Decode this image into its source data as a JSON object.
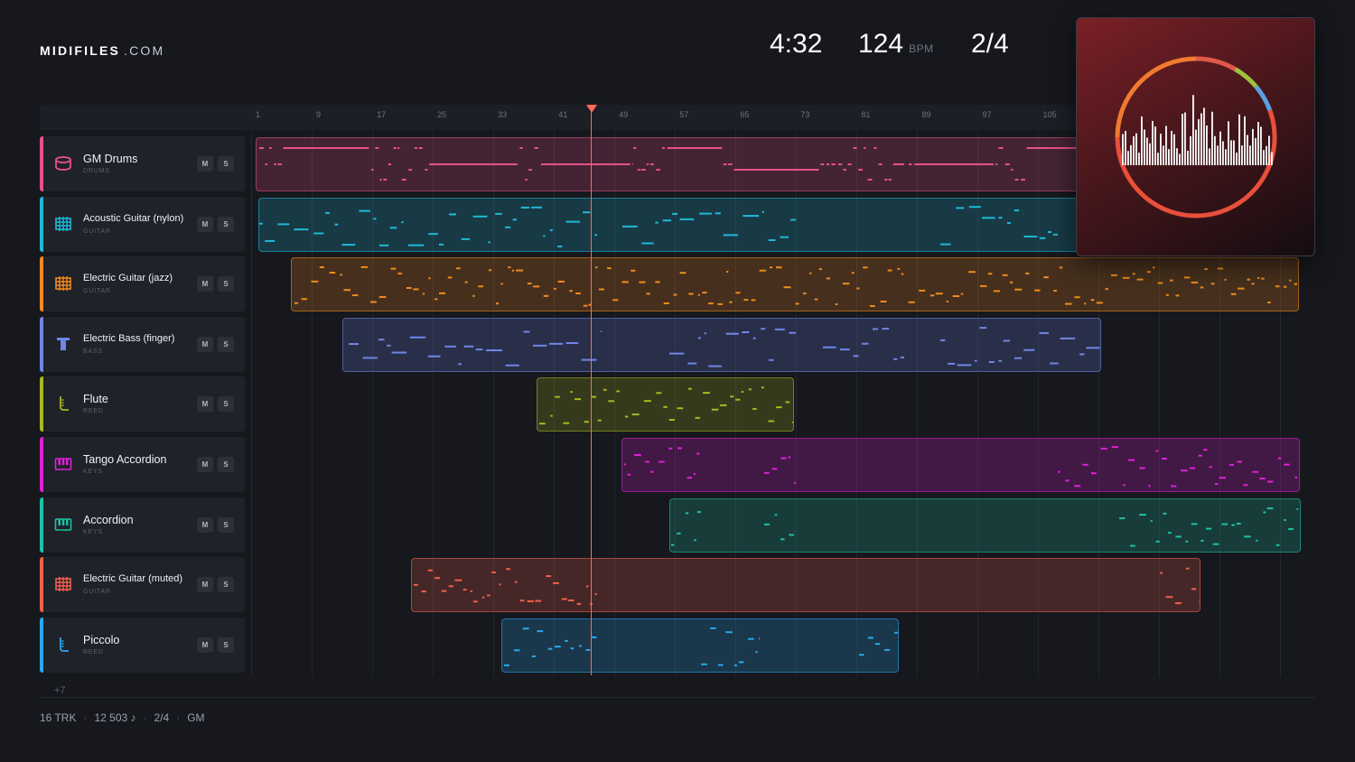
{
  "header": {
    "logo_bold": "MIDIFILES",
    "logo_thin": ".COM",
    "duration": "4:32",
    "tempo": "124",
    "tempo_unit": "BPM",
    "time_signature": "2/4"
  },
  "ruler": {
    "ticks": [
      "1",
      "9",
      "17",
      "25",
      "33",
      "41",
      "49",
      "57",
      "65",
      "73",
      "81",
      "89",
      "97",
      "105"
    ]
  },
  "playhead_bar": 45,
  "tracks": [
    {
      "name": "GM Drums",
      "category": "DRUMS",
      "color": "#e8508a",
      "icon": "drum-icon",
      "mute_label": "M",
      "solo_label": "S"
    },
    {
      "name": "Acoustic Guitar (nylon)",
      "category": "GUITAR",
      "color": "#1fb8d8",
      "icon": "guitar-fret-icon",
      "mute_label": "M",
      "solo_label": "S"
    },
    {
      "name": "Electric Guitar (jazz)",
      "category": "GUITAR",
      "color": "#f08a1e",
      "icon": "guitar-fret-icon",
      "mute_label": "M",
      "solo_label": "S"
    },
    {
      "name": "Electric Bass (finger)",
      "category": "BASS",
      "color": "#6f86e6",
      "icon": "bass-icon",
      "mute_label": "M",
      "solo_label": "S"
    },
    {
      "name": "Flute",
      "category": "REED",
      "color": "#a8b820",
      "icon": "reed-icon",
      "mute_label": "M",
      "solo_label": "S"
    },
    {
      "name": "Tango Accordion",
      "category": "KEYS",
      "color": "#e020d8",
      "icon": "keys-icon",
      "mute_label": "M",
      "solo_label": "S"
    },
    {
      "name": "Accordion",
      "category": "KEYS",
      "color": "#1ec0a4",
      "icon": "keys-icon",
      "mute_label": "M",
      "solo_label": "S"
    },
    {
      "name": "Electric Guitar (muted)",
      "category": "GUITAR",
      "color": "#f0604c",
      "icon": "guitar-fret-icon",
      "mute_label": "M",
      "solo_label": "S"
    },
    {
      "name": "Piccolo",
      "category": "REED",
      "color": "#2aa8f0",
      "icon": "reed-icon",
      "mute_label": "M",
      "solo_label": "S"
    }
  ],
  "more_tracks": "+7",
  "footer": {
    "tracks": "16 TRK",
    "notes": "12 503 ♪",
    "signature": "2/4",
    "standard": "GM"
  }
}
